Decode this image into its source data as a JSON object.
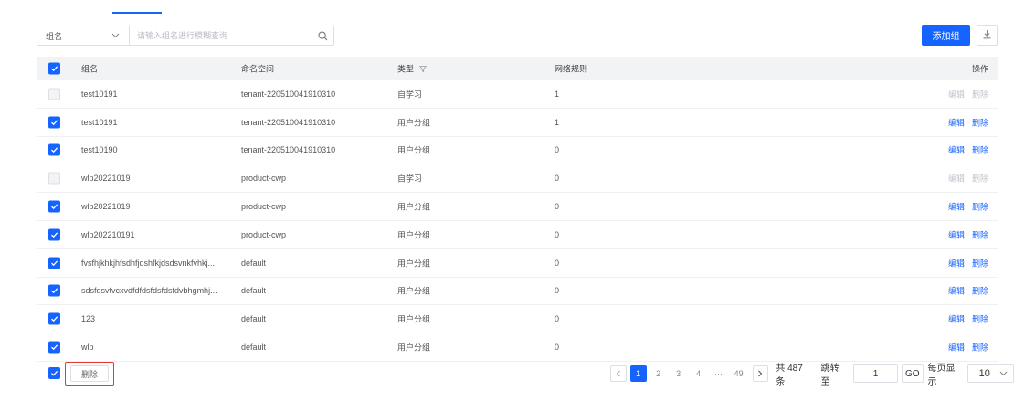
{
  "filter": {
    "field_label": "组名",
    "placeholder": "请输入组名进行模糊查询",
    "value": ""
  },
  "toolbar": {
    "add_label": "添加组",
    "download_icon": "download-icon"
  },
  "colors": {
    "accent": "#1664ff",
    "highlight_border": "#e53935"
  },
  "table": {
    "headers": {
      "name": "组名",
      "namespace": "命名空间",
      "type": "类型",
      "rules": "网络规则",
      "ops": "操作"
    },
    "rows": [
      {
        "checked": false,
        "disabled": true,
        "name": "test10191",
        "namespace": "tenant-220510041910310",
        "type": "自学习",
        "rules": "1",
        "edit": "编辑",
        "delete": "删除"
      },
      {
        "checked": true,
        "disabled": false,
        "name": "test10191",
        "namespace": "tenant-220510041910310",
        "type": "用户分组",
        "rules": "1",
        "edit": "编辑",
        "delete": "删除"
      },
      {
        "checked": true,
        "disabled": false,
        "name": "test10190",
        "namespace": "tenant-220510041910310",
        "type": "用户分组",
        "rules": "0",
        "edit": "编辑",
        "delete": "删除"
      },
      {
        "checked": false,
        "disabled": true,
        "name": "wlp20221019",
        "namespace": "product-cwp",
        "type": "自学习",
        "rules": "0",
        "edit": "编辑",
        "delete": "删除"
      },
      {
        "checked": true,
        "disabled": false,
        "name": "wlp20221019",
        "namespace": "product-cwp",
        "type": "用户分组",
        "rules": "0",
        "edit": "编辑",
        "delete": "删除"
      },
      {
        "checked": true,
        "disabled": false,
        "name": "wlp202210191",
        "namespace": "product-cwp",
        "type": "用户分组",
        "rules": "0",
        "edit": "编辑",
        "delete": "删除"
      },
      {
        "checked": true,
        "disabled": false,
        "name": "fvsfhjkhkjhfsdhfjdshfkjdsdsvnkfvhkj...",
        "namespace": "default",
        "type": "用户分组",
        "rules": "0",
        "edit": "编辑",
        "delete": "删除"
      },
      {
        "checked": true,
        "disabled": false,
        "name": "sdsfdsvfvcxvdfdfdsfdsfdsfdvbhgmhj...",
        "namespace": "default",
        "type": "用户分组",
        "rules": "0",
        "edit": "编辑",
        "delete": "删除"
      },
      {
        "checked": true,
        "disabled": false,
        "name": "123",
        "namespace": "default",
        "type": "用户分组",
        "rules": "0",
        "edit": "编辑",
        "delete": "删除"
      },
      {
        "checked": true,
        "disabled": false,
        "name": "wlp",
        "namespace": "default",
        "type": "用户分组",
        "rules": "0",
        "edit": "编辑",
        "delete": "删除"
      }
    ]
  },
  "footer": {
    "delete_label": "删除"
  },
  "pagination": {
    "pages": [
      "1",
      "2",
      "3",
      "4",
      "···",
      "49"
    ],
    "current": "1",
    "total_text": "共 487 条",
    "jump_label": "跳转至",
    "jump_value": "1",
    "go_label": "GO",
    "per_page_label": "每页显示",
    "per_page_value": "10"
  }
}
